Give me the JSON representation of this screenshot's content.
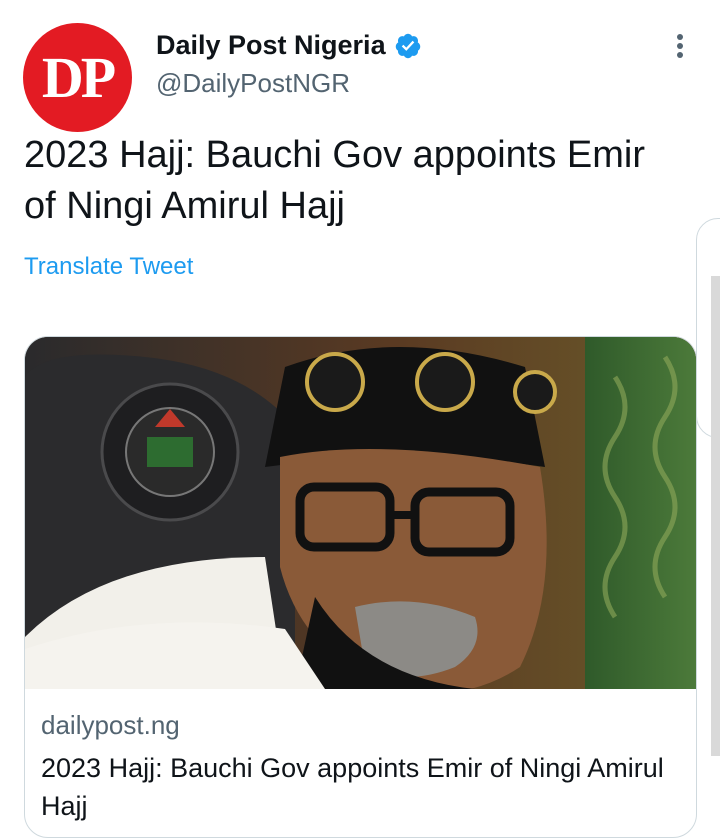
{
  "author": {
    "avatar_text": "DP",
    "display_name": "Daily Post Nigeria",
    "handle": "@DailyPostNGR",
    "avatar_color": "#e31b23",
    "verified_icon": "verified-badge-icon"
  },
  "tweet": {
    "text": "2023 Hajj: Bauchi Gov appoints Emir of Ningi Amirul Hajj",
    "translate_label": "Translate Tweet"
  },
  "card": {
    "domain": "dailypost.ng",
    "title": "2023 Hajj: Bauchi Gov appoints Emir of Ningi Amirul Hajj",
    "image_icon": "article-photo"
  },
  "colors": {
    "link": "#1d9bf0",
    "secondary_text": "#536471",
    "primary_text": "#0f1419",
    "border": "#cfd9de"
  }
}
